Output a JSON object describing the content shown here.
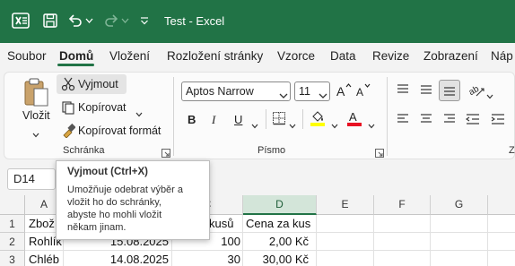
{
  "app": {
    "name": "Excel",
    "brand_color": "#217346"
  },
  "titlebar": {
    "title": "Test  -  Excel"
  },
  "tabs": [
    {
      "label": "Soubor"
    },
    {
      "label": "Domů",
      "active": true
    },
    {
      "label": "Vložení"
    },
    {
      "label": "Rozložení stránky"
    },
    {
      "label": "Vzorce"
    },
    {
      "label": "Data"
    },
    {
      "label": "Revize"
    },
    {
      "label": "Zobrazení"
    },
    {
      "label": "Náp"
    }
  ],
  "clipboard": {
    "paste_label": "Vložit",
    "cut_label": "Vyjmout",
    "copy_label": "Kopírovat",
    "format_painter_label": "Kopírovat formát",
    "group_label": "Schránka"
  },
  "font": {
    "font_name": "Aptos Narrow",
    "font_size": "11",
    "group_label": "Písmo",
    "bold": "B",
    "italic": "I",
    "underline": "U",
    "highlight_color": "#ffff00",
    "font_color": "#e81123"
  },
  "next_group_label": "Z",
  "formula_bar": {
    "name_box": "D14"
  },
  "tooltip": {
    "title": "Vyjmout (Ctrl+X)",
    "lines": [
      "Umožňuje odebrat výběr a",
      "vložit ho do schránky,",
      "abyste ho mohli vložit",
      "někam jinam."
    ]
  },
  "grid": {
    "columns": [
      "A",
      "B",
      "C",
      "D",
      "E",
      "F",
      "G"
    ],
    "selected_column": "D",
    "rows": [
      "1",
      "2",
      "3"
    ],
    "cells": {
      "a1": "Zboží",
      "c1": "kusů",
      "d1": "Cena za kus",
      "a2": "Rohlík",
      "b2": "15.08.2025",
      "c2": "100",
      "d2": "2,00 Kč",
      "a3": "Chléb",
      "b3": "14.08.2025",
      "c3": "30",
      "d3": "30,00 Kč"
    }
  }
}
